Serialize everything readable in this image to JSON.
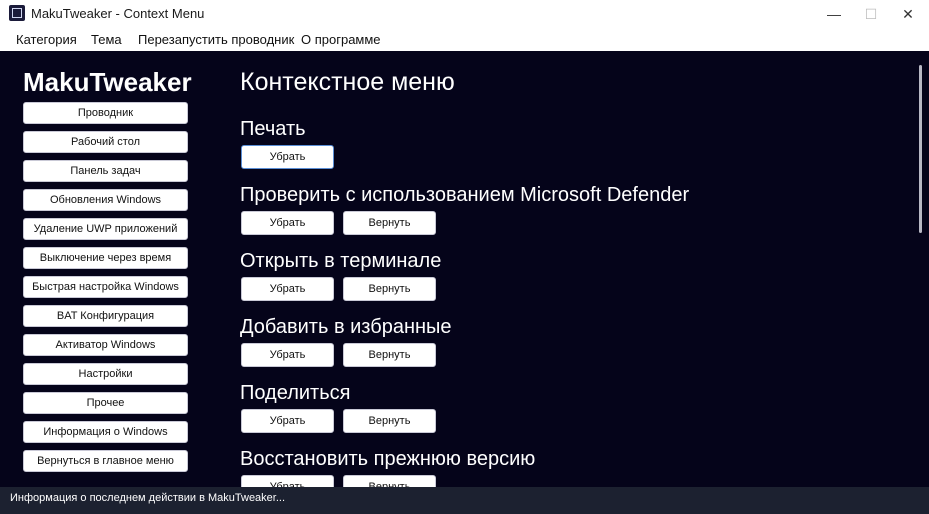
{
  "window": {
    "title": "MakuTweaker - Context Menu"
  },
  "controls": {
    "minimize": "—",
    "maximize": "☐",
    "close": "✕"
  },
  "menubar": {
    "items": [
      "Категория",
      "Тема",
      "Перезапустить проводник",
      "О программе"
    ]
  },
  "sidebar": {
    "brand": "MakuTweaker",
    "items": [
      "Проводник",
      "Рабочий стол",
      "Панель задач",
      "Обновления Windows",
      "Удаление UWP приложений",
      "Выключение через время",
      "Быстрая настройка Windows",
      "BAT Конфигурация",
      "Активатор Windows",
      "Настройки",
      "Прочее",
      "Информация о Windows",
      "Вернуться в главное меню"
    ]
  },
  "main": {
    "title": "Контекстное меню",
    "sections": [
      {
        "title": "Печать",
        "remove": "Убрать",
        "restore": ""
      },
      {
        "title": "Проверить с использованием Microsoft Defender",
        "remove": "Убрать",
        "restore": "Вернуть"
      },
      {
        "title": "Открыть в терминале",
        "remove": "Убрать",
        "restore": "Вернуть"
      },
      {
        "title": "Добавить в избранные",
        "remove": "Убрать",
        "restore": "Вернуть"
      },
      {
        "title": "Поделиться",
        "remove": "Убрать",
        "restore": "Вернуть"
      },
      {
        "title": "Восстановить прежнюю версию",
        "remove": "Убрать",
        "restore": "Вернуть"
      }
    ]
  },
  "status": {
    "text": "Информация о последнем действии в MakuTweaker..."
  },
  "colors": {
    "background": "#05041a",
    "statusbar": "#1c2130",
    "focus_border": "#5b8fd6"
  }
}
